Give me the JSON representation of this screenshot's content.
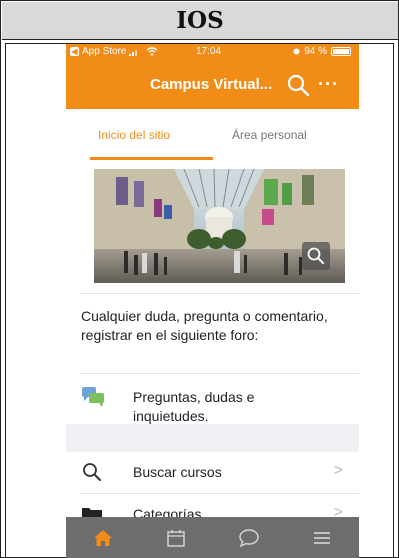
{
  "doc": {
    "heading": "IOS"
  },
  "status_bar": {
    "back_app": "App Store",
    "time": "17:04",
    "battery": "94 %"
  },
  "app_bar": {
    "title": "Campus Virtual...",
    "more_label": "···"
  },
  "tabs": [
    {
      "label": "Inicio del sitio",
      "active": true
    },
    {
      "label": "Área personal",
      "active": false
    }
  ],
  "intro_text": "Cualquier duda, pregunta o comentario, registrar en el siguiente foro:",
  "forum_link": "Preguntas, dudas e inquietudes.",
  "list_items": [
    {
      "label": "Buscar cursos",
      "icon": "search-icon"
    },
    {
      "label": "Categorías",
      "icon": "folder-icon"
    }
  ],
  "bottom_nav": [
    {
      "name": "home",
      "icon": "home-icon",
      "active": true
    },
    {
      "name": "calendar",
      "icon": "calendar-icon",
      "active": false
    },
    {
      "name": "messages",
      "icon": "chat-bubble-icon",
      "active": false
    },
    {
      "name": "menu",
      "icon": "menu-icon",
      "active": false
    }
  ],
  "colors": {
    "accent": "#f28c18",
    "nav_bar": "#6d6d6d",
    "nav_active": "#f28c18",
    "nav_inactive": "#d8d8d8"
  }
}
